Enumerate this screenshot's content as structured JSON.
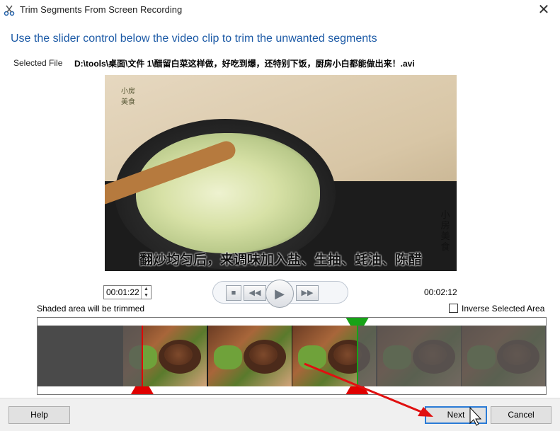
{
  "window": {
    "title": "Trim Segments From Screen Recording",
    "close_glyph": "✕",
    "app_icon": "scissors-icon"
  },
  "instruction": "Use the slider control below the video clip to trim the unwanted segments",
  "file": {
    "label": "Selected File",
    "path": "D:\\tools\\桌面\\文件 1\\醋留白菜这样做，好吃到爆，还特别下饭，厨房小白都能做出来！.avi"
  },
  "video": {
    "logo_text": "小房 美食",
    "side_text": "小房美食",
    "subtitle": "翻炒均匀后，来调味加入盐、生抽、蚝油、陈醋"
  },
  "playback": {
    "current_time": "00:01:22",
    "total_time": "00:02:12",
    "trim_start_fraction": 0.206,
    "trim_end_fraction": 0.629
  },
  "timeline": {
    "shaded_label": "Shaded area will be trimmed",
    "inverse_label": "Inverse Selected Area",
    "inverse_checked": false,
    "colors": {
      "start_marker": "#e00000",
      "end_marker": "#17a317"
    }
  },
  "buttons": {
    "help": "Help",
    "next": "Next",
    "cancel": "Cancel"
  }
}
